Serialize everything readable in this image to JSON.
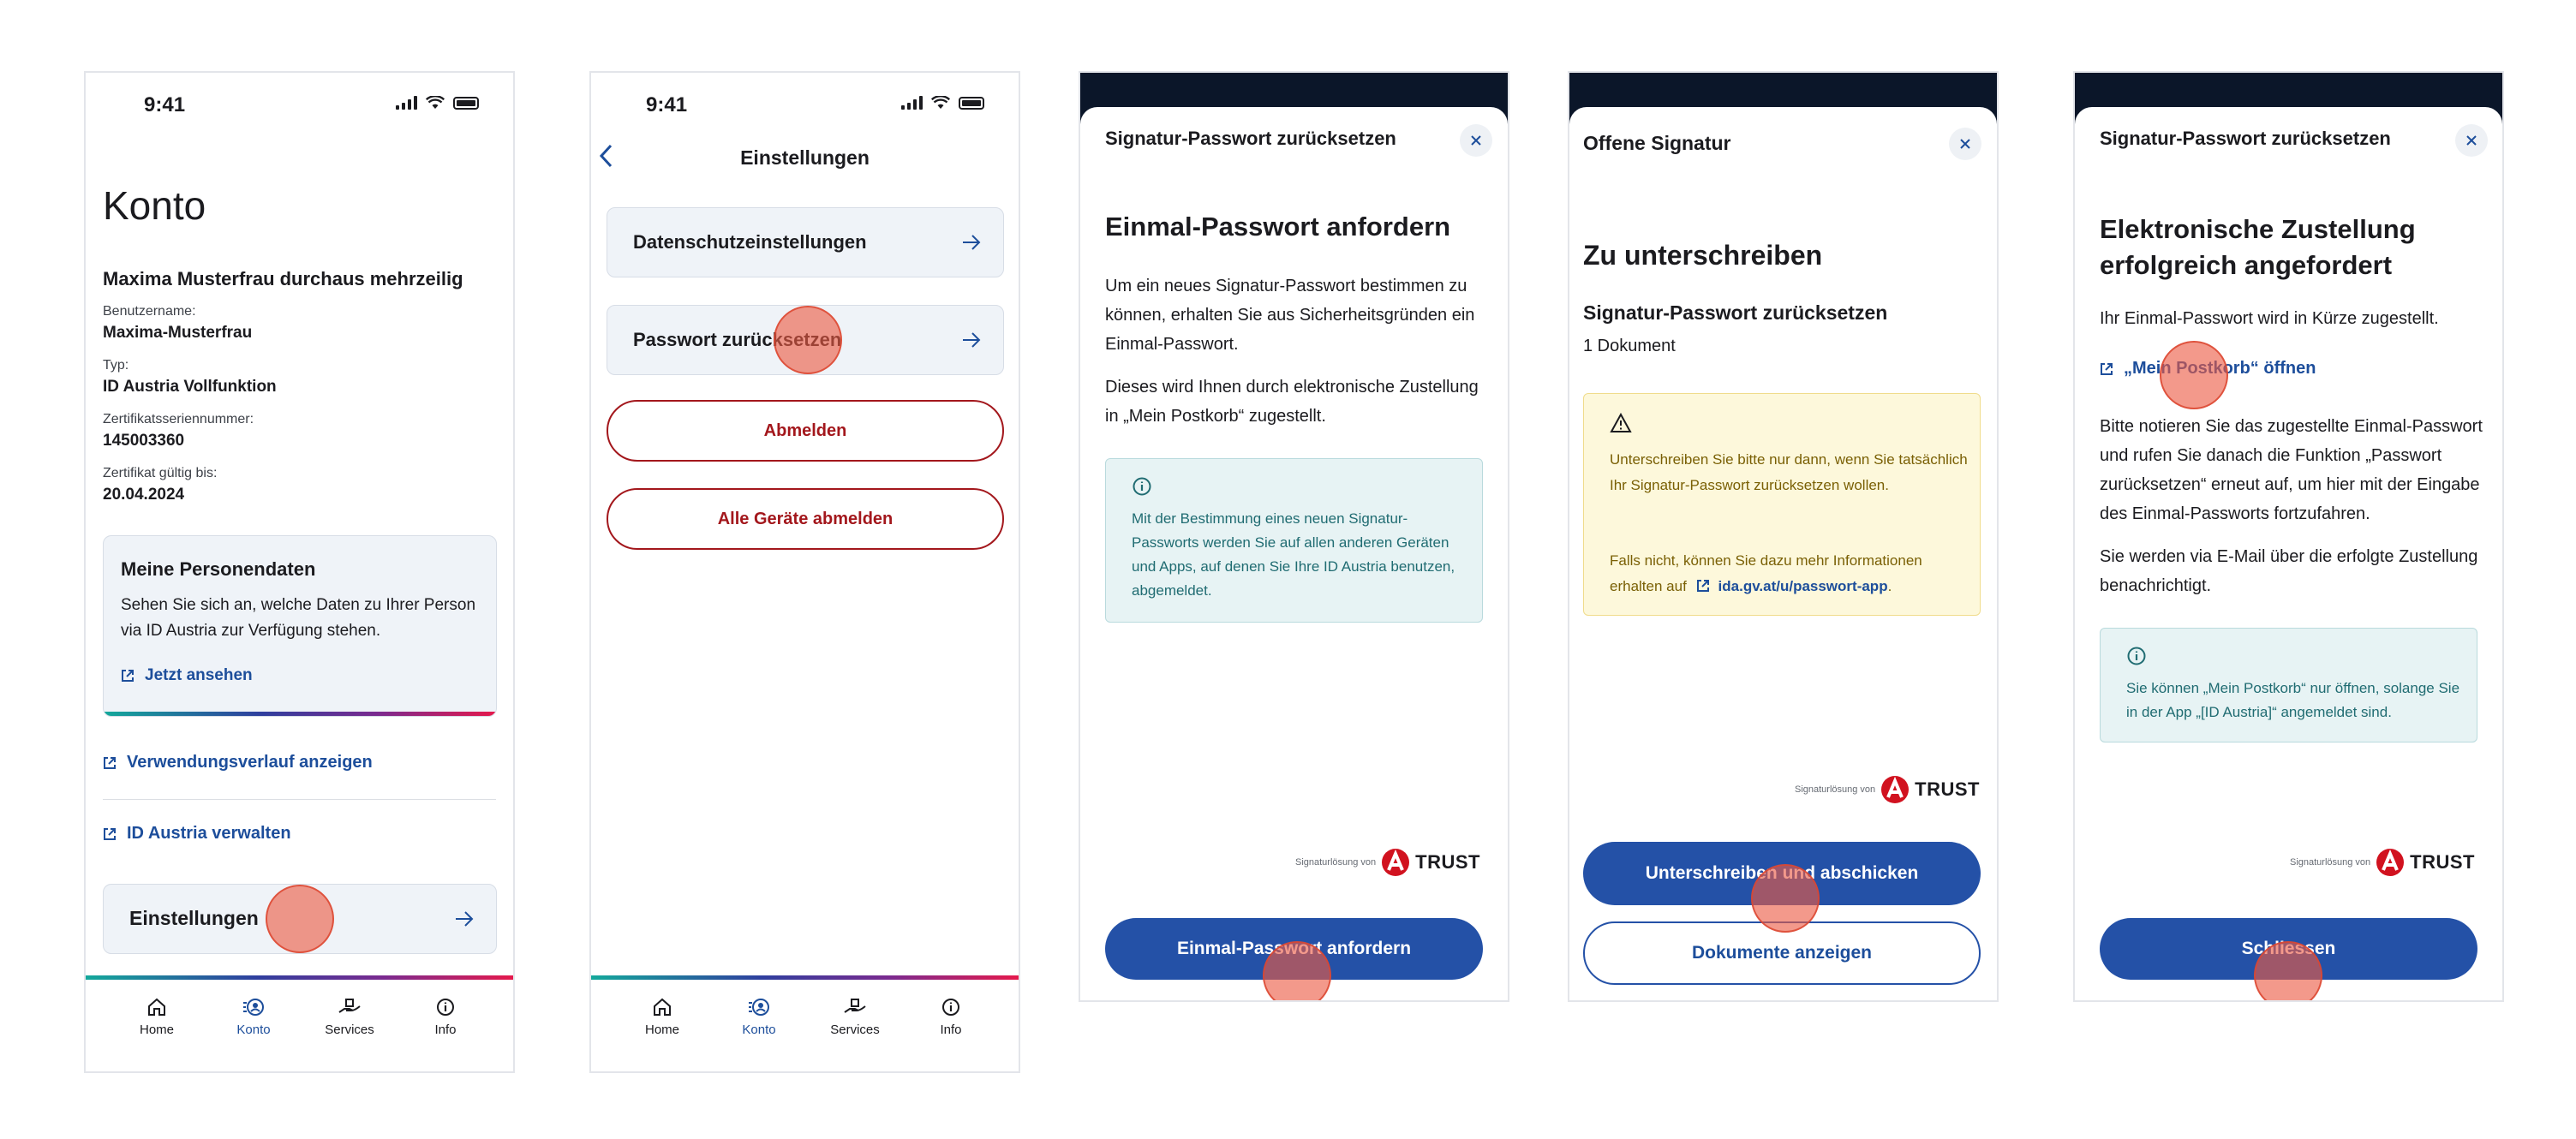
{
  "status": {
    "time": "9:41"
  },
  "tabs": [
    {
      "label": "Home",
      "icon": "home-icon"
    },
    {
      "label": "Konto",
      "icon": "account-icon"
    },
    {
      "label": "Services",
      "icon": "services-icon"
    },
    {
      "label": "Info",
      "icon": "info-icon"
    }
  ],
  "screen1": {
    "title": "Konto",
    "name": "Maxima Musterfrau durchaus mehrzeilig",
    "fields": [
      {
        "label": "Benutzername:",
        "value": "Maxima-Musterfrau"
      },
      {
        "label": "Typ:",
        "value": "ID Austria Vollfunktion"
      },
      {
        "label": "Zertifikatsseriennummer:",
        "value": "145003360"
      },
      {
        "label": "Zertifikat gültig bis:",
        "value": "20.04.2024"
      }
    ],
    "personal_card": {
      "title": "Meine Personendaten",
      "text": "Sehen Sie sich an, welche Daten zu Ihrer Person via ID Austria zur Verfügung stehen.",
      "link": "Jetzt ansehen"
    },
    "link_history": "Verwendungsverlauf anzeigen",
    "link_manage": "ID Austria verwalten",
    "settings": "Einstellungen"
  },
  "screen2": {
    "title": "Einstellungen",
    "privacy": "Datenschutzeinstellungen",
    "reset_password": "Passwort zurücksetzen",
    "logout": "Abmelden",
    "logout_all": "Alle Geräte abmelden"
  },
  "screen3": {
    "sheet_title": "Signatur-Passwort zurücksetzen",
    "heading": "Einmal-Passwort anfordern",
    "para1": "Um ein neues Signatur-Passwort bestimmen zu können, erhalten Sie aus Sicherheitsgründen ein Einmal-Passwort.",
    "para2": "Dieses wird Ihnen durch elektronische Zustellung in „Mein Postkorb“ zugestellt.",
    "info": "Mit der Bestimmung eines neuen Signatur-Passworts werden Sie auf allen anderen Geräten und Apps, auf denen Sie Ihre ID Austria benutzen, abgemeldet.",
    "trust_prefix": "Signaturlösung von",
    "trust_brand": "TRUST",
    "button": "Einmal-Passwort anfordern"
  },
  "screen4": {
    "sheet_title": "Offene Signatur",
    "heading": "Zu unterschreiben",
    "subheading": "Signatur-Passwort zurücksetzen",
    "count": "1 Dokument",
    "warn1": "Unterschreiben Sie bitte nur dann, wenn Sie tatsächlich Ihr Signatur-Passwort zurücksetzen wollen.",
    "warn2_prefix": "Falls nicht, können Sie dazu mehr Informationen erhalten auf",
    "warn2_link": "ida.gv.at/u/passwort-app",
    "trust_prefix": "Signaturlösung von",
    "trust_brand": "TRUST",
    "button_sign": "Unterschreiben und abschicken",
    "button_docs": "Dokumente anzeigen"
  },
  "screen5": {
    "sheet_title": "Signatur-Passwort zurücksetzen",
    "heading": "Elektronische Zustellung erfolgreich angefordert",
    "para1": "Ihr Einmal-Passwort wird in Kürze zugestellt.",
    "link": "„Mein Postkorb“ öffnen",
    "para2": "Bitte notieren Sie das zugestellte Einmal-Passwort und rufen Sie danach die Funktion „Passwort zurücksetzen“ erneut auf, um hier mit der Eingabe des Einmal-Passworts fortzufahren.",
    "para3": "Sie werden via E-Mail über die erfolgte Zustellung benachrichtigt.",
    "info": "Sie können „Mein Postkorb“ nur öffnen, solange Sie in der App „[ID Austria]“ angemeldet sind.",
    "trust_prefix": "Signaturlösung von",
    "trust_brand": "TRUST",
    "button": "Schliessen"
  },
  "colors": {
    "primary": "#2451a7",
    "link": "#1d4e9b",
    "danger": "#a3171c",
    "info_bg": "#e7f3f4",
    "warn_bg": "#fdf8db",
    "tap_indicator": "#ec5a44"
  }
}
